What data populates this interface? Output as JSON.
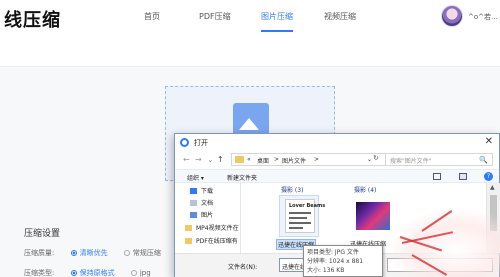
{
  "site": {
    "logo": "线压缩",
    "nav": [
      "首页",
      "PDF压缩",
      "图片压缩",
      "视频压缩"
    ],
    "nav_active_index": 2,
    "username": "^o^若..."
  },
  "settings": {
    "title": "压缩设置",
    "quality_label": "压缩质量:",
    "quality_options": [
      "清晰优先",
      "常规压缩"
    ],
    "quality_selected": 0,
    "type_label": "压缩类型:",
    "type_options": [
      "保持原格式",
      "jpg"
    ],
    "type_selected": 0
  },
  "dialog": {
    "title": "打开",
    "close": "✕",
    "nav": {
      "back": "←",
      "forward": "→",
      "dropdown": "⌄",
      "up": "↑",
      "refresh": "↻"
    },
    "breadcrumb": [
      "«",
      "桌面",
      ">",
      "图片文件",
      ">"
    ],
    "address_dropdown": "⌄",
    "search_placeholder": "搜索\"图片文件\"",
    "search_icon": "🔍",
    "toolbar": {
      "organize": "组织 ▾",
      "new_folder": "新建文件夹",
      "help": "?"
    },
    "sidebar": [
      {
        "icon": "download-icon",
        "label": "下载",
        "pinned": true
      },
      {
        "icon": "document-icon",
        "label": "文档",
        "pinned": true
      },
      {
        "icon": "picture-icon",
        "label": "图片",
        "pinned": true
      },
      {
        "icon": "folder-icon",
        "label": "MP4视频文件在",
        "pinned": false
      },
      {
        "icon": "folder-icon",
        "label": "PDF在线压缩有",
        "pinned": false
      }
    ],
    "pin_glyph": "📌",
    "groups": [
      "摄影 (3)",
      "摄影 (4)"
    ],
    "files": [
      {
        "name": "迅捷在线压缩",
        "thumb_title": "Lover Beams",
        "selected": true
      },
      {
        "name": "迅捷在线压缩",
        "thumb_title": "",
        "selected": false
      }
    ],
    "scroll_up": "▲",
    "filename_label": "文件名(N):",
    "filename_value": "迅捷在线压缩",
    "filename_dropdown": "⌄",
    "tooltip": [
      "项目类型: JPG 文件",
      "分辨率: 1024 x 881",
      "大小: 136 KB"
    ]
  },
  "colors": {
    "accent": "#2f7bf6",
    "watermark": "#d62e2e"
  }
}
